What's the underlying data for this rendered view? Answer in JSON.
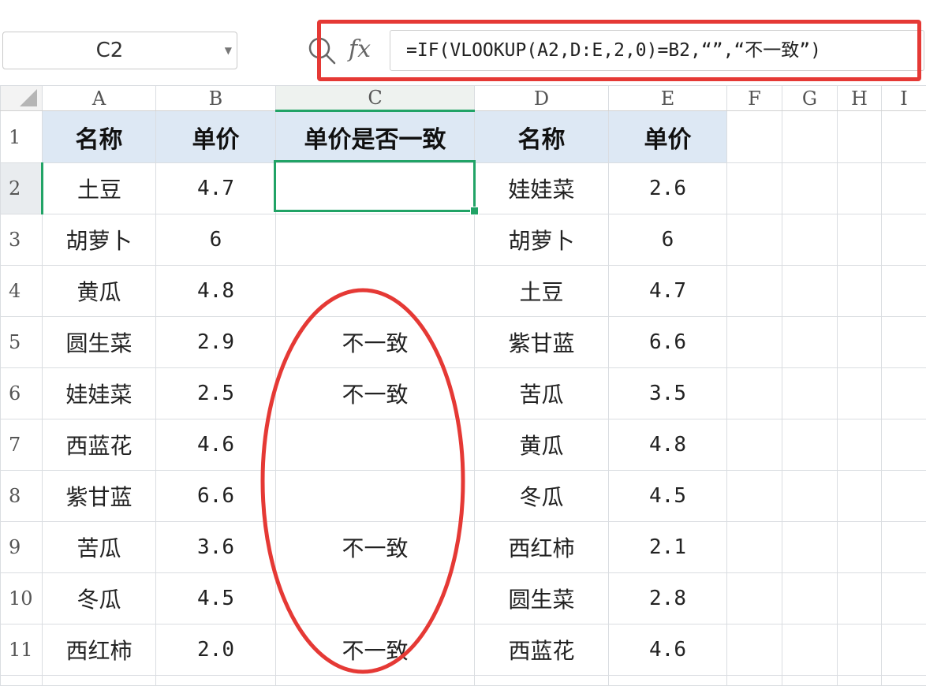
{
  "formula_bar": {
    "name_box": "C2",
    "fx_label": "fx",
    "formula": "=IF(VLOOKUP(A2,D:E,2,0)=B2,“”,“不一致”)"
  },
  "columns": [
    "A",
    "B",
    "C",
    "D",
    "E",
    "F",
    "G",
    "H",
    "I"
  ],
  "row_numbers": [
    "1",
    "2",
    "3",
    "4",
    "5",
    "6",
    "7",
    "8",
    "9",
    "10",
    "11"
  ],
  "sheet": {
    "headers": [
      "名称",
      "单价",
      "单价是否一致",
      "名称",
      "单价"
    ],
    "rows": [
      [
        "土豆",
        "4.7",
        "",
        "娃娃菜",
        "2.6"
      ],
      [
        "胡萝卜",
        "6",
        "",
        "胡萝卜",
        "6"
      ],
      [
        "黄瓜",
        "4.8",
        "",
        "土豆",
        "4.7"
      ],
      [
        "圆生菜",
        "2.9",
        "不一致",
        "紫甘蓝",
        "6.6"
      ],
      [
        "娃娃菜",
        "2.5",
        "不一致",
        "苦瓜",
        "3.5"
      ],
      [
        "西蓝花",
        "4.6",
        "",
        "黄瓜",
        "4.8"
      ],
      [
        "紫甘蓝",
        "6.6",
        "",
        "冬瓜",
        "4.5"
      ],
      [
        "苦瓜",
        "3.6",
        "不一致",
        "西红柿",
        "2.1"
      ],
      [
        "冬瓜",
        "4.5",
        "",
        "圆生菜",
        "2.8"
      ],
      [
        "西红柿",
        "2.0",
        "不一致",
        "西蓝花",
        "4.6"
      ]
    ]
  },
  "colors": {
    "selection": "#21a366",
    "header_fill": "#dde8f4",
    "annotation": "#e53935"
  }
}
